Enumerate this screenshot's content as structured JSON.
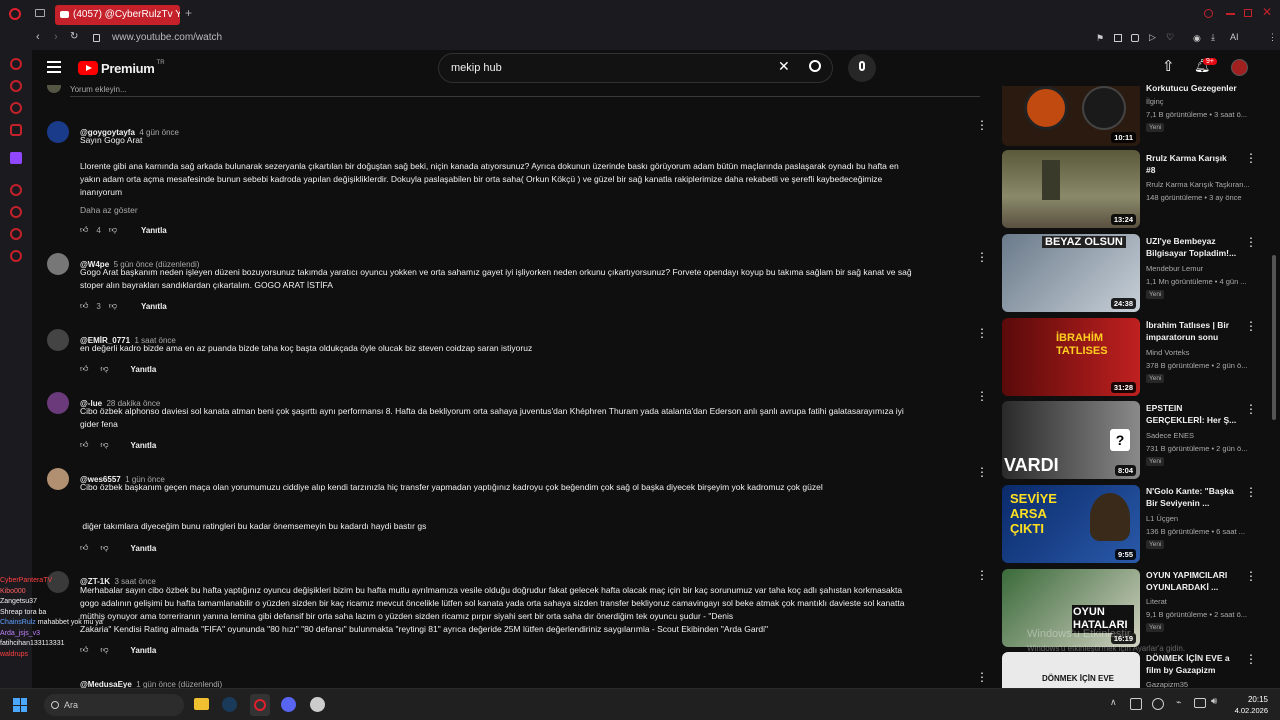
{
  "browser": {
    "tab_title": "(4057) @CyberRulzTv YAY",
    "url": "www.youtube.com/watch",
    "ai_label": "AI"
  },
  "header": {
    "logo_text": "Premium",
    "logo_region": "TR",
    "search_value": "mekip hub",
    "notif_badge": "9+"
  },
  "add_comment_placeholder": "Yorum ekleyin...",
  "comments": [
    {
      "author": "@goygoytayfa",
      "time": "4 gün önce",
      "lines": [
        "Sayın Gogo Arat",
        "",
        "Llorente gibi ana karnında sağ arkada bulunarak sezeryanla çıkartılan bir doğuştan sağ beki, niçin kanada atıyorsunuz? Ayrıca dokunun üzerinde baskı görüyorum adam bütün maçlarında paslaşarak oynadı bu hafta en",
        "yakın adam orta açma mesafesinde bunun sebebi kadroda yapılan değişikliklerdir. Dokuyla paslaşabilen bir orta saha( Orkun Kökçü ) ve güzel bir sağ kanatla rakiplerimize daha rekabetli ve şerefli kaybedeceğimize",
        "inanıyorum"
      ],
      "show_less": "Daha az göster",
      "likes": "4",
      "reply": "Yanıtla"
    },
    {
      "author": "@W4pe",
      "time": "5 gün önce (düzenlendi)",
      "lines": [
        "Gogo Arat başkanım neden işleyen düzeni bozuyorsunuz takımda yaratıcı oyuncu yokken ve orta sahamız gayet iyi işliyorken neden orkunu çıkartıyorsunuz? Forvete opendayı koyup bu takıma sağlam bir sağ kanat ve sağ",
        "stoper alın bayrakları sandıklardan çıkartalım. GOGO ARAT İSTİFA"
      ],
      "likes": "3",
      "reply": "Yanıtla"
    },
    {
      "author": "@EMİR_0771",
      "time": "1 saat önce",
      "lines": [
        "en değerli kadro bizde ama en az puanda bizde taha koç başta oldukçada öyle olucak biz steven coidzap saran istiyoruz"
      ],
      "likes": "",
      "reply": "Yanıtla"
    },
    {
      "author": "@-lue",
      "time": "28 dakika önce",
      "lines": [
        "Cibo özbek alphonso daviesi sol kanata atman beni çok şaşırttı aynı performansı 8. Hafta da bekliyorum  orta sahaya juventus'dan Khéphren Thuram yada atalanta'dan Ederson anlı şanlı avrupa fatihi galatasarayımıza iyi",
        "gider  fena"
      ],
      "likes": "",
      "reply": "Yanıtla"
    },
    {
      "author": "@wes6557",
      "time": "1 gün önce",
      "lines": [
        "Cibo özbek başkanım geçen maça olan yorumumuzu ciddiye alıp kendi tarzınızla hiç transfer yapmadan yaptığınız kadroyu çok beğendim çok sağ ol başka diyecek birşeyim yok kadromuz çok güzel",
        "",
        "",
        " diğer takımlara diyeceğim bunu ratingleri bu kadar önemsemeyin bu kadardı haydi bastır gs"
      ],
      "likes": "",
      "reply": "Yanıtla"
    },
    {
      "author": "@ZT-1K",
      "time": "3 saat önce",
      "lines": [
        "Merhabalar sayın cibo özbek bu hafta yaptığınız oyuncu değişikleri  bizim bu hafta mutlu ayrılmamıza vesile olduğu doğrudur fakat gelecek hafta olacak maç için bir kaç sorunumuz var  taha koç adlı şahıstan korkmasakta",
        "gogo adalının gelişimi bu hafta tamamlanabilir o yüzden sizden bir kaç ricamız mevcut öncelikle lütfen sol kanata yada orta sahaya sizden transfer bekliyoruz camavingayı sol beke atmak çok mantıklı davieste sol kanatta",
        "müthiş oynuyor ama torreriranın yanına lemina gibi defansif bir orta saha lazım o yüzden sizden ricamız pırpır siyahi sert bir orta saha dır önerdiğim tek oyuncu şudur - \"Denis",
        "Zakaria\" Kendisi Rating almada \"FIFA\" oyununda \"80 hızı\" \"80 defansı\" bulunmakta \"reytingi 81\" ayrıca değeride 25M lütfen değerlendiriniz saygılarımla - Scout Ekibinden \"Arda Gardi\""
      ],
      "likes": "",
      "reply": "Yanıtla"
    },
    {
      "author": "@MedusaEye",
      "time": "1 gün önce (düzenlendi)",
      "lines": [],
      "likes": "",
      "reply": ""
    }
  ],
  "recommendations": [
    {
      "title": "Korkutucu Gezegenler",
      "channel": "İlginç",
      "views": "7,1 B görüntüleme • 3 saat ö...",
      "badge": "Yeni",
      "duration": "10:11",
      "thumb_color": "#3a1a0a"
    },
    {
      "title": "Rrulz Karma Karışık #8",
      "channel": "Rrulz Karma Karışık Taşkıran...",
      "views": "148 görüntüleme • 3 ay önce",
      "badge": "",
      "duration": "13:24",
      "thumb_color": "#6a6a4a"
    },
    {
      "title": "UZI'ye Bembeyaz Bilgisayar Topladim!...",
      "channel": "Mendebur Lemur",
      "views": "1,1 Mn görüntüleme • 4 gün ...",
      "badge": "Yeni",
      "duration": "24:38",
      "thumb_color": "#5a6a7a",
      "thumb_text": "BEYAZ OLSUN"
    },
    {
      "title": "İbrahim Tatlıses | Bir imparatorun sonu",
      "channel": "Mind Vorteks",
      "views": "378 B görüntüleme • 2 gün ö...",
      "badge": "Yeni",
      "duration": "31:28",
      "thumb_color": "#8a1a1a",
      "thumb_text": "İBRAHİM TATLISES"
    },
    {
      "title": "EPSTEIN GERÇEKLERİ: Her Ş...",
      "channel": "Sadece ENES",
      "views": "731 B görüntüleme • 2 gün ö...",
      "badge": "Yeni",
      "duration": "8:04",
      "thumb_color": "#4a4a4a",
      "thumb_text": "VARDI"
    },
    {
      "title": "N'Golo Kante: \"Başka Bir Seviyenin ...",
      "channel": "L1 Üçgen",
      "views": "136 B görüntüleme • 6 saat ...",
      "badge": "Yeni",
      "duration": "9:55",
      "thumb_color": "#1a3a7a",
      "thumb_text": "SEVİYE ARSA ÇIKTI"
    },
    {
      "title": "OYUN YAPIMCILARI OYUNLARDAKİ ...",
      "channel": "Literat",
      "views": "9,1 B görüntüleme • 2 saat ö...",
      "badge": "Yeni",
      "duration": "16:19",
      "thumb_color": "#2a5a2a",
      "thumb_text": "OYUN HATALARI"
    },
    {
      "title": "DÖNMEK İÇİN EVE a film by Gazapizm",
      "channel": "Gazapizm35",
      "views": "",
      "badge": "",
      "duration": "",
      "thumb_color": "#e8e8e8",
      "thumb_text": "DÖNMEK İÇİN EVE"
    }
  ],
  "chat": [
    {
      "user": "CyberPanteraTV",
      "msg": "",
      "color": "#ff4040"
    },
    {
      "user": "Kibo000",
      "msg": "",
      "color": "#ff6060"
    },
    {
      "user": "Zangetsu37",
      "msg": "",
      "color": "#f0f0f0"
    },
    {
      "user": "Shreap",
      "msg": "tora ba",
      "color": "#f0f0f0"
    },
    {
      "user": "ChainsRulz",
      "msg": "mahabbet yok mu ya",
      "color": "#60a0ff"
    },
    {
      "user": "Arda_jsjs_v3",
      "msg": "",
      "color": "#c080ff"
    },
    {
      "user": "fatihcihan133113331",
      "msg": "",
      "color": "#f0f0f0"
    },
    {
      "user": "waldrups",
      "msg": "",
      "color": "#ff4040"
    }
  ],
  "watermark": {
    "line1": "Windows'u Etkinleştir",
    "line2": "Windows'u etkinleştirmek için Ayarlar'a gidin."
  },
  "taskbar": {
    "search_label": "Ara",
    "time": "20:15",
    "date": "4.02.2026"
  }
}
